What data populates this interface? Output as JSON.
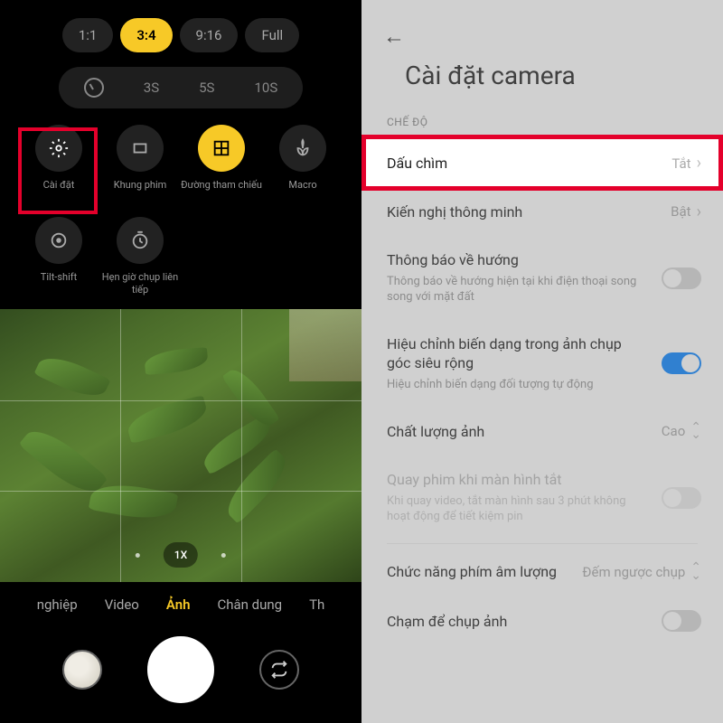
{
  "camera": {
    "ratios": [
      "1:1",
      "3:4",
      "9:16",
      "Full"
    ],
    "active_ratio": "3:4",
    "timers": [
      "3S",
      "5S",
      "10S"
    ],
    "options": [
      {
        "label": "Cài đặt",
        "icon": "gear"
      },
      {
        "label": "Khung phim",
        "icon": "frame"
      },
      {
        "label": "Đường tham chiếu",
        "icon": "grid",
        "yellow": true
      },
      {
        "label": "Macro",
        "icon": "macro"
      },
      {
        "label": "Tilt-shift",
        "icon": "target"
      },
      {
        "label": "Hẹn giờ chụp liên tiếp",
        "icon": "timer"
      }
    ],
    "zoom": "1X",
    "modes": [
      "nghiệp",
      "Video",
      "Ảnh",
      "Chân dung",
      "Th"
    ],
    "active_mode": "Ảnh"
  },
  "settings": {
    "title": "Cài đặt camera",
    "section": "CHẾ ĐỘ",
    "items": [
      {
        "name": "Dấu chìm",
        "value": "Tắt",
        "type": "nav",
        "highlighted": true
      },
      {
        "name": "Kiến nghị thông minh",
        "value": "Bật",
        "type": "nav"
      },
      {
        "name": "Thông báo về hướng",
        "desc": "Thông báo về hướng hiện tại khi điện thoại song song với mặt đất",
        "type": "toggle",
        "on": false
      },
      {
        "name": "Hiệu chỉnh biến dạng trong ảnh chụp góc siêu rộng",
        "desc": "Hiệu chỉnh biến dạng đối tượng tự động",
        "type": "toggle",
        "on": true
      },
      {
        "name": "Chất lượng ảnh",
        "value": "Cao",
        "type": "select"
      },
      {
        "name": "Quay phim khi màn hình tắt",
        "desc": "Khi quay video, tắt màn hình sau 3 phút không hoạt động để tiết kiệm pin",
        "type": "toggle",
        "on": false,
        "disabled": true
      },
      {
        "name": "Chức năng phím âm lượng",
        "value": "Đếm ngược chụp",
        "type": "select",
        "divider_before": true
      },
      {
        "name": "Chạm để chụp ảnh",
        "desc": "",
        "type": "toggle",
        "on": false
      }
    ]
  }
}
